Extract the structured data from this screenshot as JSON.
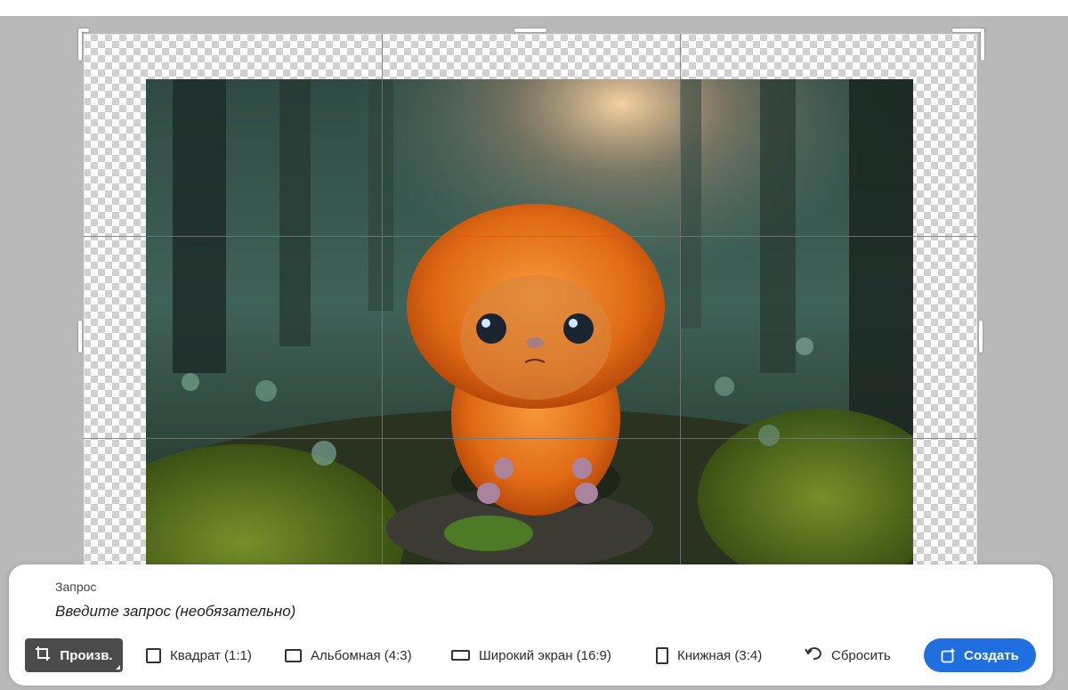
{
  "prompt": {
    "label": "Запрос",
    "placeholder": "Введите запрос (необязательно)"
  },
  "toolbar": {
    "items": [
      {
        "label": "Произв.",
        "icon": "crop-icon",
        "active": true
      },
      {
        "label": "Квадрат (1:1)",
        "icon": "square-ratio-icon",
        "active": false
      },
      {
        "label": "Альбомная (4:3)",
        "icon": "landscape-ratio-icon",
        "active": false
      },
      {
        "label": "Широкий экран (16:9)",
        "icon": "widescreen-ratio-icon",
        "active": false
      },
      {
        "label": "Книжная (3:4)",
        "icon": "portrait-ratio-icon",
        "active": false
      },
      {
        "label": "Сбросить",
        "icon": "undo-icon",
        "active": false
      }
    ],
    "create_label": "Создать",
    "create_icon": "generate-sparkle-icon"
  },
  "colors": {
    "accent": "#1f6fe0",
    "active_tool": "#4b4b4b",
    "backdrop": "#b9b9b9"
  }
}
